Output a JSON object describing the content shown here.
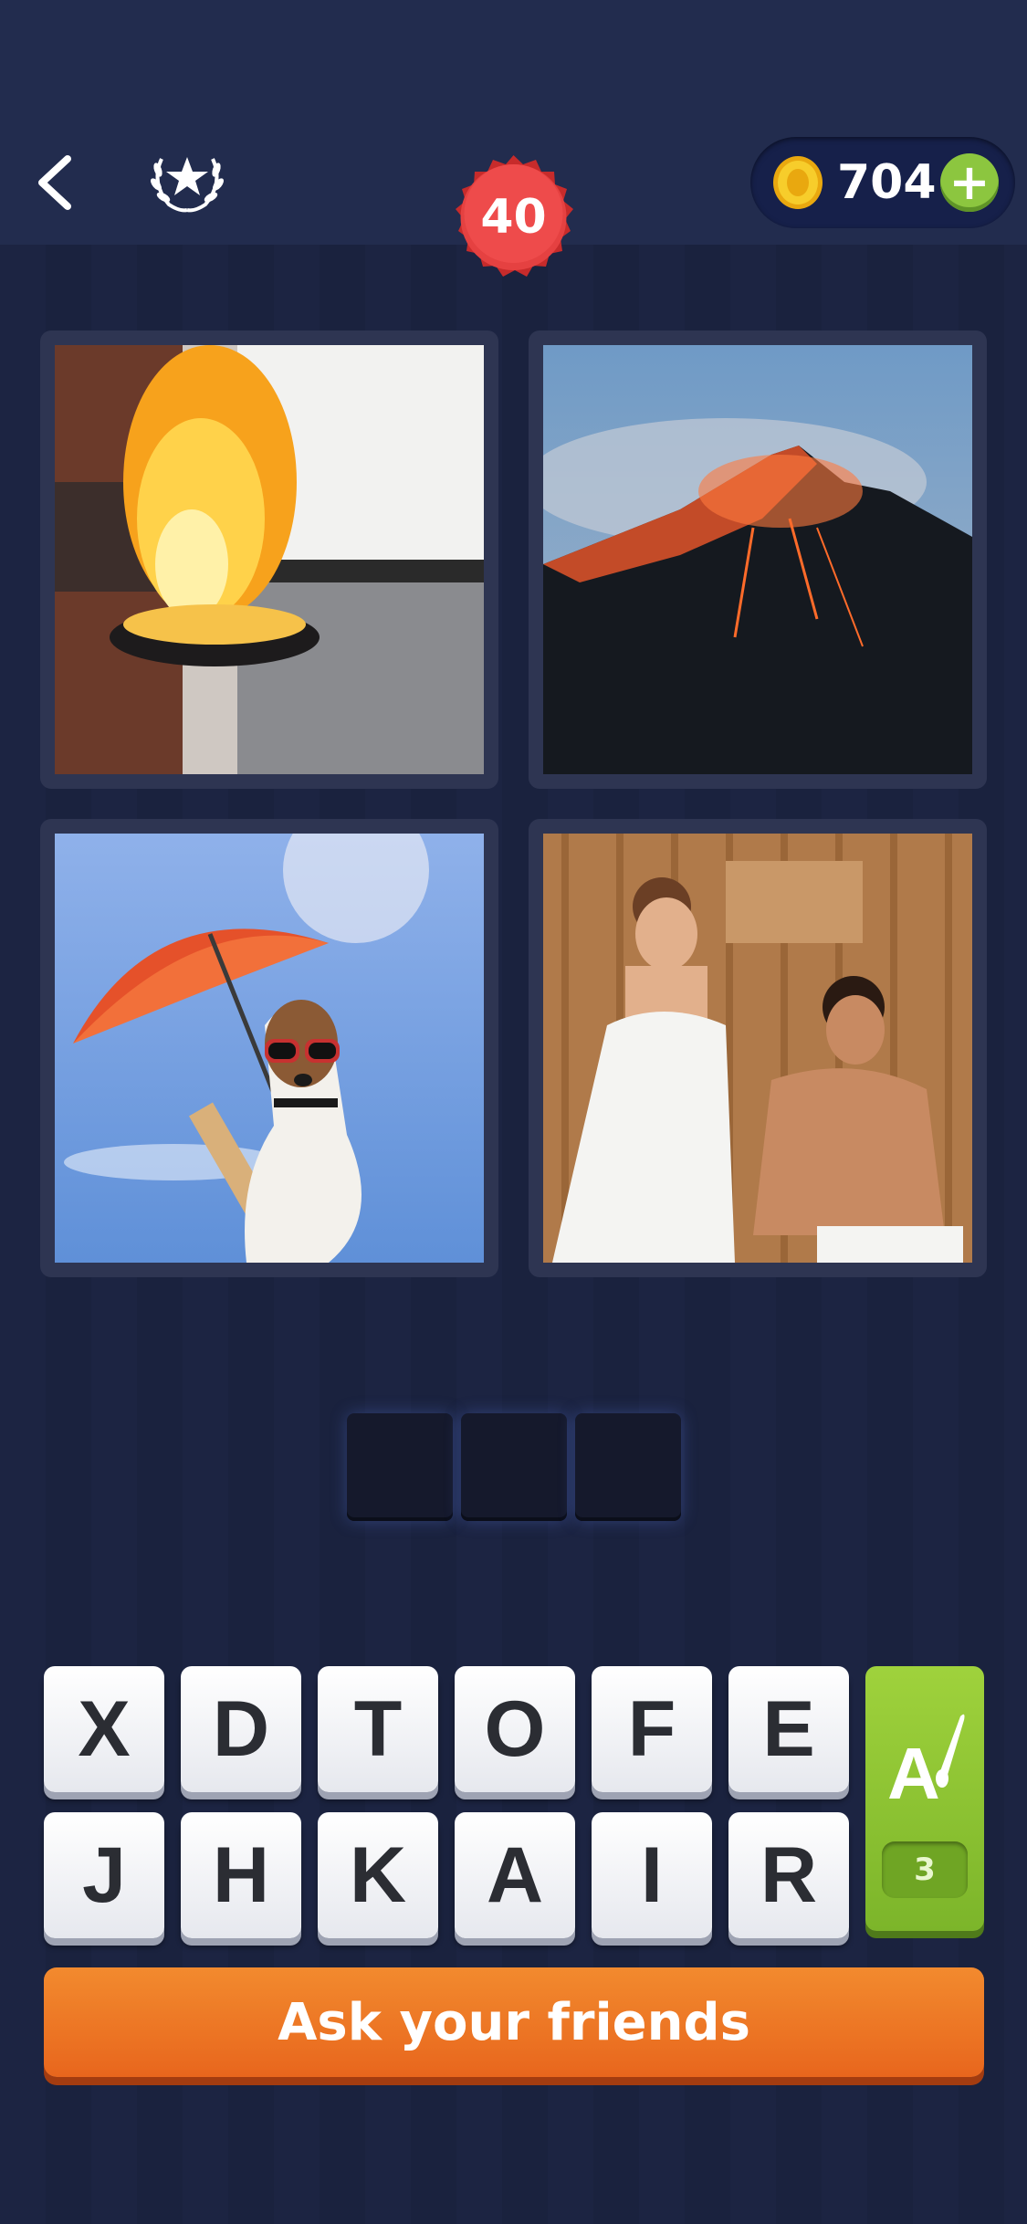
{
  "header": {
    "back_icon": "chevron-left-icon",
    "achievements_icon": "laurel-star-icon",
    "level": "40",
    "coins": "704",
    "coin_icon": "gold-coin-icon",
    "add_coins_label": "+"
  },
  "puzzle": {
    "pictures": [
      {
        "name": "flaming-pan",
        "icon": "photo-chef-flambe"
      },
      {
        "name": "volcano",
        "icon": "photo-erupting-volcano"
      },
      {
        "name": "dog-umbrella",
        "icon": "photo-dog-sunglasses-umbrella"
      },
      {
        "name": "sauna",
        "icon": "photo-couple-sauna"
      }
    ],
    "answer_length": 3
  },
  "keyboard": {
    "row1": [
      "X",
      "D",
      "T",
      "O",
      "F",
      "E"
    ],
    "row2": [
      "J",
      "H",
      "K",
      "A",
      "I",
      "R"
    ]
  },
  "hint": {
    "icon": "letter-brush-icon",
    "count": "3"
  },
  "ask_button": {
    "label": "Ask your friends"
  },
  "colors": {
    "background": "#1c2442",
    "level_badge": "#e03a3a",
    "hint_green": "#8cc63f",
    "ask_orange": "#ee7a28"
  }
}
